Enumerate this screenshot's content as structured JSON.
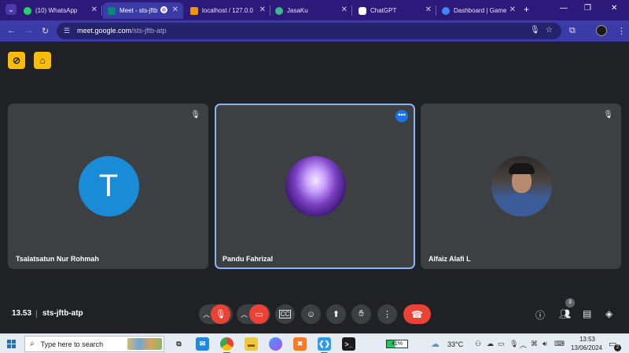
{
  "browser": {
    "tabs": [
      {
        "title": "(10) WhatsApp",
        "favicon": "whatsapp-icon",
        "color": "#25d366"
      },
      {
        "title": "Meet - sts-jftb",
        "favicon": "meet-icon",
        "color": "#00897b"
      },
      {
        "title": "localhost / 127.0.0",
        "favicon": "phpmyadmin-icon",
        "color": "#f29111"
      },
      {
        "title": "JasaKu",
        "favicon": "jasaku-icon",
        "color": "#3fb68b"
      },
      {
        "title": "ChatGPT",
        "favicon": "chatgpt-icon",
        "color": "#ffffff"
      },
      {
        "title": "Dashboard | Game",
        "favicon": "google-icon",
        "color": "#4285f4"
      }
    ],
    "url_host": "meet.google.com",
    "url_path": "/sts-jftb-atp"
  },
  "meeting": {
    "participants": [
      {
        "name": "Tsalatsatun Nur Rohmah",
        "initial": "T",
        "avatar": "letter-avatar",
        "muted": true
      },
      {
        "name": "Pandu Fahrizal",
        "avatar": "galaxy-photo-avatar",
        "muted": false,
        "speaking": true
      },
      {
        "name": "Alfaiz Alafi L",
        "avatar": "photo-avatar",
        "muted": true
      }
    ],
    "time": "13.53",
    "separator": "|",
    "code": "sts-jftb-atp",
    "people_count": "3",
    "colors": {
      "hangup": "#ea4335",
      "accent": "#8ab4f8",
      "warn": "#fbbc04"
    }
  },
  "taskbar": {
    "search_placeholder": "Type here to search",
    "battery": "41%",
    "temperature": "33°C",
    "time": "13:53",
    "date": "13/06/2024",
    "notification_count": "2"
  }
}
